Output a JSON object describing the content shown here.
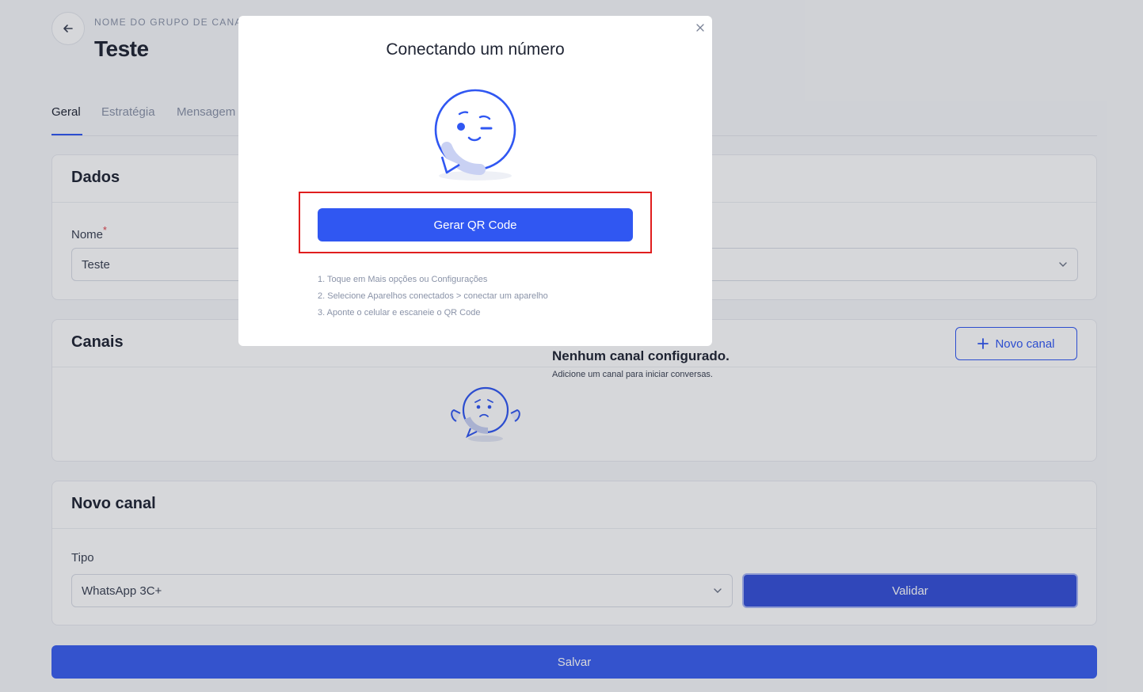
{
  "header": {
    "breadcrumb": "NOME DO GRUPO DE CANAIS",
    "title": "Teste"
  },
  "tabs": [
    {
      "label": "Geral",
      "active": true
    },
    {
      "label": "Estratégia",
      "active": false
    },
    {
      "label": "Mensagem",
      "active": false
    }
  ],
  "dados": {
    "title": "Dados",
    "nome_label": "Nome",
    "required_mark": "*",
    "nome_value": "Teste"
  },
  "canais": {
    "title": "Canais",
    "new_button": "Novo canal",
    "empty_title": "Nenhum canal configurado.",
    "empty_sub": "Adicione um canal para iniciar conversas."
  },
  "novo_canal": {
    "title": "Novo canal",
    "tipo_label": "Tipo",
    "tipo_value": "WhatsApp 3C+",
    "validate_button": "Validar"
  },
  "footer": {
    "save_button": "Salvar"
  },
  "modal": {
    "title": "Conectando um número",
    "qr_button": "Gerar QR Code",
    "steps": [
      "1. Toque em Mais opções ou Configurações",
      "2. Selecione Aparelhos conectados > conectar um aparelho",
      "3. Aponte o celular e escaneie o QR Code"
    ]
  },
  "colors": {
    "primary": "#3057f2",
    "highlight": "#e01e1e"
  },
  "icons": {
    "back": "arrow-left-icon",
    "plus": "plus-icon",
    "chevron": "chevron-down-icon",
    "close": "close-icon"
  }
}
